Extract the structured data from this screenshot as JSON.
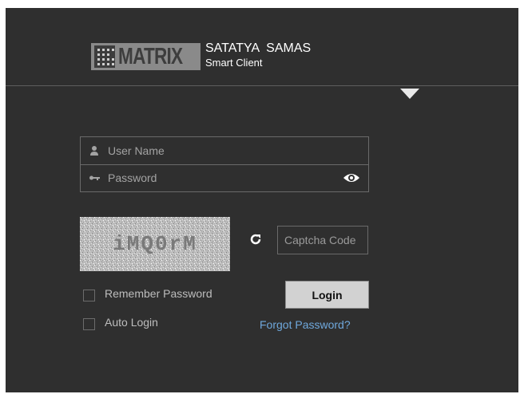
{
  "brand": {
    "logo_text": "MATRIX",
    "title": "SATATYA  SAMAS",
    "subtitle": "Smart Client"
  },
  "login_form": {
    "username": {
      "placeholder": "User Name",
      "value": "",
      "icon": "user-icon"
    },
    "password": {
      "placeholder": "Password",
      "value": "",
      "icon": "key-icon",
      "toggle_icon": "eye-icon"
    },
    "captcha": {
      "image_text": "iMQ0rM",
      "refresh_icon": "refresh-icon",
      "input_placeholder": "Captcha Code",
      "input_value": ""
    },
    "remember_password": {
      "label": "Remember Password",
      "checked": false
    },
    "auto_login": {
      "label": "Auto Login",
      "checked": false
    },
    "login_button": "Login",
    "forgot_link": "Forgot Password?"
  },
  "colors": {
    "background": "#2f2f2f",
    "text_muted": "#a3a3a3",
    "link": "#6fa8dc",
    "button": "#d2d2d2"
  }
}
